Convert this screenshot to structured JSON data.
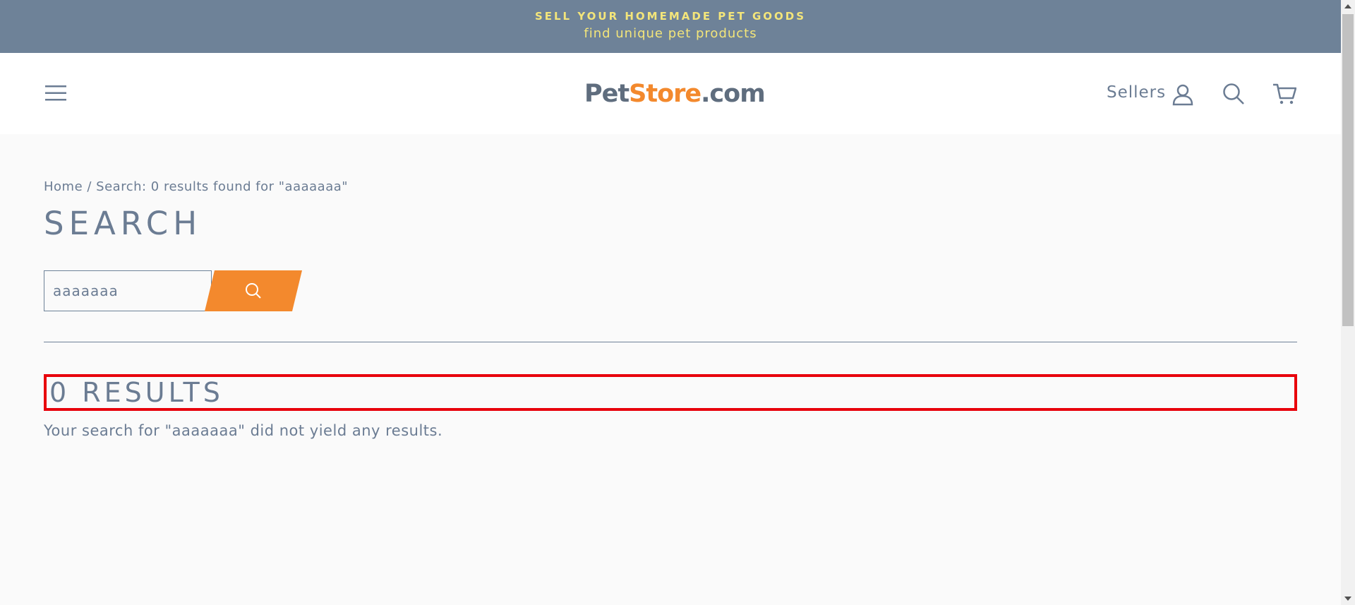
{
  "announcement": {
    "line1": "SELL YOUR HOMEMADE PET GOODS",
    "line2": "find unique pet products"
  },
  "header": {
    "menu_icon": "hamburger-menu-icon",
    "logo": {
      "part1": "Pet",
      "part2": "Store",
      "part3": ".com"
    },
    "sellers_label": "Sellers",
    "account_icon": "user-icon",
    "search_icon": "search-icon",
    "cart_icon": "cart-icon"
  },
  "breadcrumb": {
    "home": "Home",
    "separator": " / ",
    "current": "Search: 0 results found for \"aaaaaaa\""
  },
  "page": {
    "title": "SEARCH"
  },
  "search": {
    "value": "aaaaaaa",
    "submit_icon": "search-icon"
  },
  "results": {
    "heading": "0 RESULTS",
    "message": "Your search for \"aaaaaaa\" did not yield any results."
  },
  "colors": {
    "announcement_bg": "#6e8298",
    "announcement_text": "#f3e57a",
    "accent": "#f3892d",
    "text": "#6b7c93",
    "highlight_border": "#e8000b"
  }
}
